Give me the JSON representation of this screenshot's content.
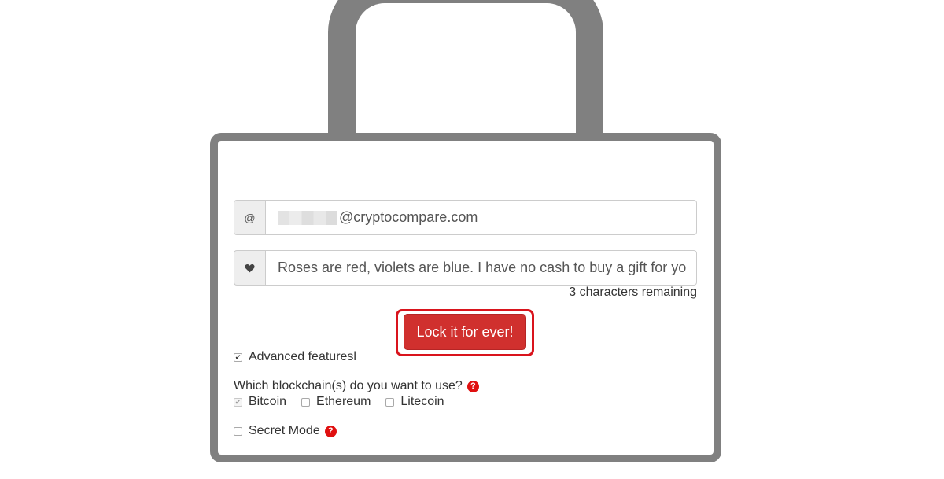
{
  "form": {
    "email": {
      "addon_symbol": "@",
      "value_domain": "@cryptocompare.com"
    },
    "message": {
      "value": "Roses are red, violets are blue. I have no cash to buy a gift for yo"
    },
    "chars_remaining": "3 characters remaining",
    "submit_label": "Lock it for ever!",
    "advanced_features_label": "Advanced featuresl",
    "blockchain_question": "Which blockchain(s) do you want to use?",
    "blockchains": [
      {
        "label": "Bitcoin"
      },
      {
        "label": "Ethereum"
      },
      {
        "label": "Litecoin"
      }
    ],
    "secret_mode_label": "Secret Mode",
    "help_symbol": "?"
  },
  "icons": {
    "email_addon": "at-icon",
    "message_addon": "heart-icon",
    "help": "question-circle-icon"
  },
  "colors": {
    "lock_outline": "#808080",
    "button_red": "#d0302e",
    "highlight_red": "#d9141d",
    "help_red": "#e01010"
  }
}
